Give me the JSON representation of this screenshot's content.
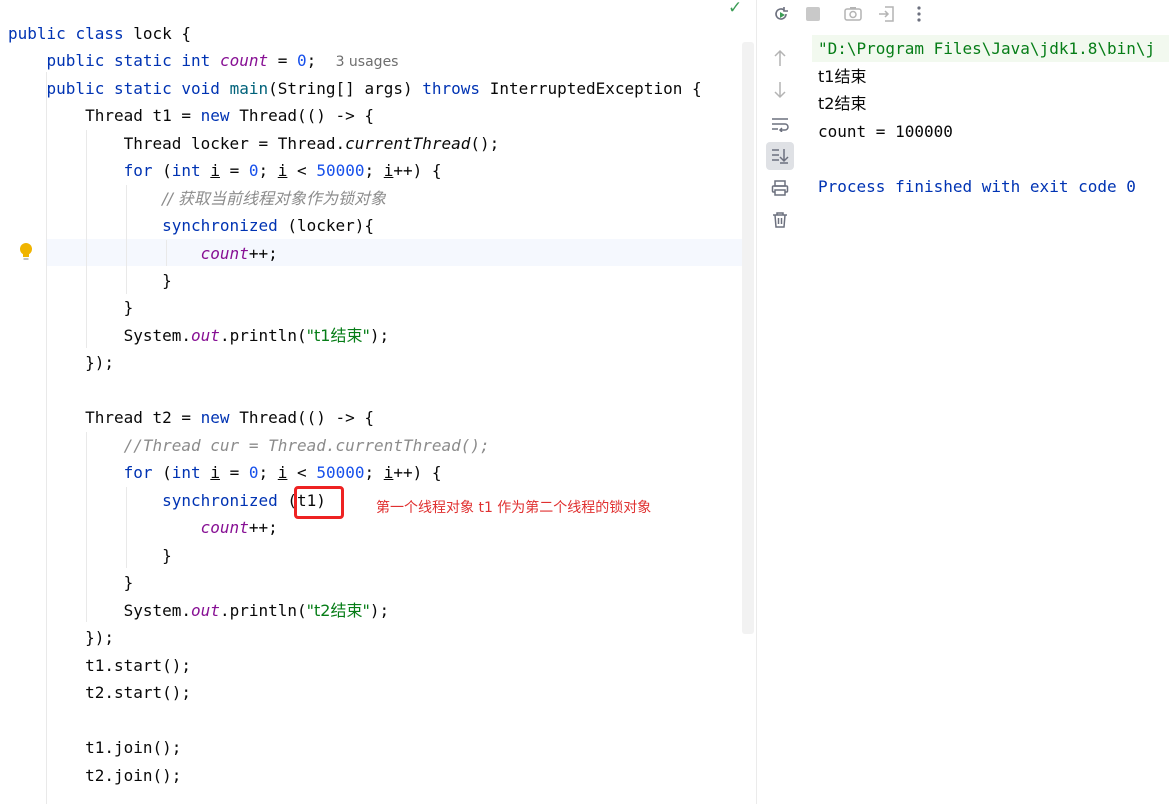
{
  "editor": {
    "tokens": {
      "public": "public",
      "class": "class",
      "lock": "lock",
      "brace_open": "{",
      "static": "static",
      "int": "int",
      "count": "count",
      "eq_zero_pre": " = ",
      "zero": "0",
      "semicolon": ";",
      "void": "void",
      "main": "main",
      "string_args": "(String[] args)",
      "throws": "throws",
      "interrupted": "InterruptedException {",
      "thread_t1": "Thread t1 = ",
      "new": "new",
      "thread_lambda": " Thread(() -> {",
      "thread_locker": "Thread locker = Thread.",
      "currentThread": "currentThread",
      "parens_semi": "();",
      "for": "for",
      "paren_open": " (",
      "i": "i",
      "eq": " = ",
      "semi_sp": "; ",
      "lt": " < ",
      "fifty_k": "50000",
      "pp": "++) {",
      "synchronized": "synchronized",
      "locker_arg": " (locker){",
      "count_pp": "++;",
      "close_brace": "}",
      "system": "System.",
      "out": "out",
      "println_open": ".println(",
      "close_lambda": "});",
      "thread_t2": "Thread t2 = ",
      "t1_arg": " (t1)",
      "t1_start": "t1.start();",
      "t2_start": "t2.start();",
      "t1_join": "t1.join();",
      "t2_join": "t2.join();",
      "println_close": ");"
    },
    "usages_hint": "3 usages",
    "comment_lock": "// 获取当前线程对象作为锁对象",
    "comment_cur": "//Thread cur = Thread.currentThread();",
    "str_t1_done": "\"t1结束\"",
    "str_t2_done": "\"t2结束\"",
    "annotation": "第一个线程对象 t1 作为第二个线程的锁对象"
  },
  "console": {
    "lines": {
      "cmd": "\"D:\\Program Files\\Java\\jdk1.8\\bin\\j",
      "t1_done": "t1结束",
      "t2_done": "t2结束",
      "count": "count = 100000",
      "process": "Process finished with exit code 0"
    }
  },
  "icons": [
    "check-icon",
    "lightbulb-icon",
    "rerun-icon",
    "stop-icon",
    "screenshot-icon",
    "exit-icon",
    "more-icon",
    "up-arrow-icon",
    "down-arrow-icon",
    "soft-wrap-icon",
    "scroll-to-end-icon",
    "print-icon",
    "trash-icon"
  ],
  "colors": {
    "keyword": "#0033b3",
    "string": "#067d17",
    "field": "#871094",
    "number": "#1750eb",
    "comment": "#8c8c8c",
    "annotation": "#e03030"
  }
}
